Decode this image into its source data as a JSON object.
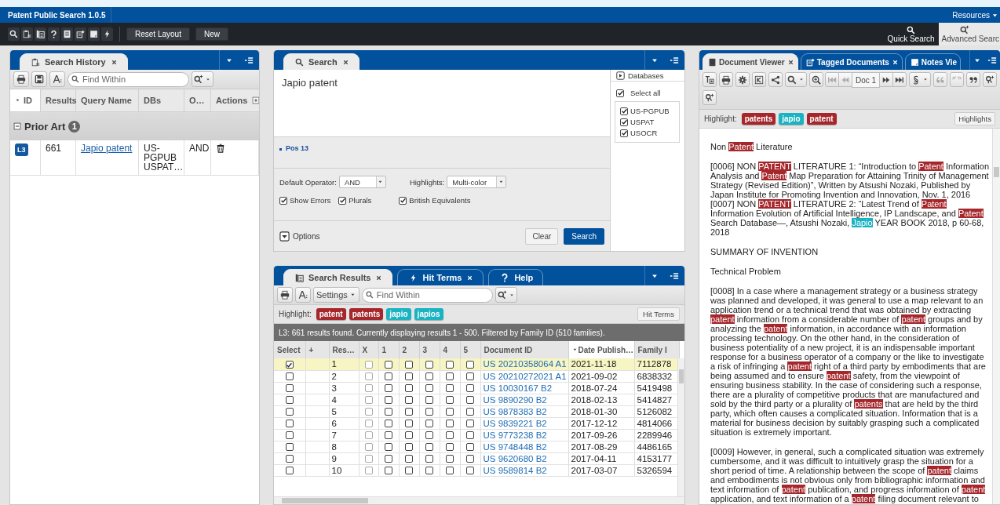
{
  "app": {
    "title": "Patent Public Search 1.0.5",
    "resources_menu": "Resources"
  },
  "toolbar": {
    "buttons": [
      "Reset Layout",
      "New"
    ],
    "quick_search": "Quick Search",
    "advanced_search": "Advanced Searc"
  },
  "search_history": {
    "tabs": [
      {
        "label": "Search History",
        "selected": true
      }
    ],
    "find_placeholder": "Find Within",
    "columns": [
      {
        "label": "ID",
        "sorted": true
      },
      {
        "label": "Results",
        "sorted": false
      },
      {
        "label": "Query Name",
        "sorted": false
      },
      {
        "label": "DBs",
        "sorted": false
      },
      {
        "label": "O…",
        "sorted": false
      },
      {
        "label": "Actions",
        "sorted": false
      }
    ],
    "group": {
      "name": "Prior Art",
      "count": "1",
      "expanded": true
    },
    "rows": [
      {
        "id": "L3",
        "results": "661",
        "query": "Japio patent",
        "dbs": "US-PGPUB USPAT…",
        "operator": "AND"
      }
    ]
  },
  "search": {
    "tabs": [
      {
        "label": "Search",
        "selected": true
      }
    ],
    "query": "Japio patent",
    "position": "Pos 13",
    "default_operator": {
      "label": "Default Operator:",
      "value": "AND"
    },
    "highlights": {
      "label": "Highlights:",
      "value": "Multi-color"
    },
    "options": [
      {
        "label": "Show Errors",
        "checked": true
      },
      {
        "label": "Plurals",
        "checked": true
      },
      {
        "label": "British Equivalents",
        "checked": true
      }
    ],
    "options_toggle": "Options",
    "buttons": [
      "Clear",
      "Search"
    ],
    "databases": {
      "title": "Databases",
      "select_all": {
        "label": "Select all",
        "checked": true
      },
      "items": [
        {
          "label": "US-PGPUB",
          "checked": true
        },
        {
          "label": "USPAT",
          "checked": true
        },
        {
          "label": "USOCR",
          "checked": true
        }
      ]
    }
  },
  "results": {
    "tabs": [
      {
        "label": "Search Results",
        "selected": true
      },
      {
        "label": "Hit Terms",
        "selected": false
      },
      {
        "label": "Help",
        "selected": false
      }
    ],
    "settings": "Settings",
    "find_placeholder": "Find Within",
    "highlight_label": "Highlight:",
    "terms": [
      {
        "text": "patent",
        "color": "#a5262b"
      },
      {
        "text": "patents",
        "color": "#a5262b"
      },
      {
        "text": "japio",
        "color": "#19b3c2"
      },
      {
        "text": "japios",
        "color": "#19b3c2"
      }
    ],
    "hit_terms_button": "Hit Terms",
    "status": "L3: 661 results found. Currently displaying results 1 - 500. Filtered by Family ID (510 families).",
    "columns": [
      {
        "label": "Select",
        "sorted": false
      },
      {
        "label": "+",
        "sorted": false
      },
      {
        "label": "Res…",
        "sorted": false
      },
      {
        "label": "X",
        "sorted": false
      },
      {
        "label": "1",
        "sorted": false
      },
      {
        "label": "2",
        "sorted": false
      },
      {
        "label": "3",
        "sorted": false
      },
      {
        "label": "4",
        "sorted": false
      },
      {
        "label": "5",
        "sorted": false
      },
      {
        "label": "Document ID",
        "sorted": false
      },
      {
        "label": "Date Publish…",
        "sorted": true
      },
      {
        "label": "Family I",
        "sorted": false
      }
    ],
    "rows": [
      {
        "selected": true,
        "checked": true,
        "result": "1",
        "marks": [
          false,
          false,
          false,
          false,
          false,
          false
        ],
        "document_id": "US 20210358064 A1",
        "date": "2021-11-18",
        "family_id": "7112878"
      },
      {
        "selected": false,
        "checked": false,
        "result": "2",
        "marks": [
          false,
          false,
          false,
          false,
          false,
          false
        ],
        "document_id": "US 20210272021 A1",
        "date": "2021-09-02",
        "family_id": "6838332"
      },
      {
        "selected": false,
        "checked": false,
        "result": "3",
        "marks": [
          false,
          false,
          false,
          false,
          false,
          false
        ],
        "document_id": "US 10030167 B2",
        "date": "2018-07-24",
        "family_id": "5419498"
      },
      {
        "selected": false,
        "checked": false,
        "result": "4",
        "marks": [
          false,
          false,
          false,
          false,
          false,
          false
        ],
        "document_id": "US 9890290 B2",
        "date": "2018-02-13",
        "family_id": "5414827"
      },
      {
        "selected": false,
        "checked": false,
        "result": "5",
        "marks": [
          false,
          false,
          false,
          false,
          false,
          false
        ],
        "document_id": "US 9878383 B2",
        "date": "2018-01-30",
        "family_id": "5126082"
      },
      {
        "selected": false,
        "checked": false,
        "result": "6",
        "marks": [
          false,
          false,
          false,
          false,
          false,
          false
        ],
        "document_id": "US 9839221 B2",
        "date": "2017-12-12",
        "family_id": "4814066"
      },
      {
        "selected": false,
        "checked": false,
        "result": "7",
        "marks": [
          false,
          false,
          false,
          false,
          false,
          false
        ],
        "document_id": "US 9773238 B2",
        "date": "2017-09-26",
        "family_id": "2289946"
      },
      {
        "selected": false,
        "checked": false,
        "result": "8",
        "marks": [
          false,
          false,
          false,
          false,
          false,
          false
        ],
        "document_id": "US 9748448 B2",
        "date": "2017-08-29",
        "family_id": "4486165"
      },
      {
        "selected": false,
        "checked": false,
        "result": "9",
        "marks": [
          false,
          false,
          false,
          false,
          false,
          false
        ],
        "document_id": "US 9620680 B2",
        "date": "2017-04-11",
        "family_id": "4153177"
      },
      {
        "selected": false,
        "checked": false,
        "result": "10",
        "marks": [
          false,
          false,
          false,
          false,
          false,
          false
        ],
        "document_id": "US 9589814 B2",
        "date": "2017-03-07",
        "family_id": "5326594"
      }
    ]
  },
  "doc_viewer": {
    "tabs": [
      {
        "label": "Document Viewer",
        "selected": true
      },
      {
        "label": "Tagged Documents",
        "selected": false
      },
      {
        "label": "Notes Vie",
        "selected": false
      }
    ],
    "doc_position": "Doc 1",
    "highlight_label": "Highlight:",
    "terms": [
      {
        "text": "patents",
        "color": "#a5262b"
      },
      {
        "text": "japio",
        "color": "#19b3c2"
      },
      {
        "text": "patent",
        "color": "#a5262b"
      }
    ],
    "highlights_button": "Highlights",
    "blocks": [
      [
        [
          "Non ",
          {
            "text": "Patent",
            "color": "#a5262b"
          },
          " Literature"
        ]
      ],
      [
        [
          "[0006] NON ",
          {
            "text": "PATENT",
            "color": "#a5262b"
          },
          " LITERATURE 1: “Introduction to ",
          {
            "text": "Patent",
            "color": "#a5262b"
          },
          " Information Analysis and ",
          {
            "text": "Patent",
            "color": "#a5262b"
          },
          " Map Preparation for Attaining Trinity of Management Strategy (Revised Edition)”, Written by Atsushi Nozaki, Published by Japan Institute for Promoting Invention and Innovation, Nov. 1, 2016"
        ],
        [
          "[0007] NON ",
          {
            "text": "PATENT",
            "color": "#a5262b"
          },
          " LITERATURE 2: “Latest Trend of ",
          {
            "text": "Patent",
            "color": "#a5262b"
          },
          " Information Evolution of Artificial Intelligence, IP Landscape, and ",
          {
            "text": "Patent",
            "color": "#a5262b"
          },
          " Search Database—, Atsushi Nozaki, ",
          {
            "text": "Japio",
            "color": "#19b3c2"
          },
          " YEAR BOOK 2018, p 60-68, 2018"
        ]
      ],
      [
        [
          "SUMMARY OF INVENTION"
        ]
      ],
      [
        [
          "Technical Problem"
        ]
      ],
      [
        [
          "[0008] In a case where a management strategy or a business strategy was planned and developed, it was general to use a map relevant to an application trend or a technical trend that was obtained by extracting ",
          {
            "text": "patent",
            "color": "#a5262b"
          },
          " information from a considerable number of ",
          {
            "text": "patent",
            "color": "#a5262b"
          },
          " groups and by analyzing the ",
          {
            "text": "patent",
            "color": "#a5262b"
          },
          " information, in accordance with an information processing technology. On the other hand, in the consideration of business potentiality of a new project, it is an indispensable important response for a business operator of a company or the like to investigate a risk of infringing a ",
          {
            "text": "patent",
            "color": "#a5262b"
          },
          " right of a third party by embodiments that are being assumed and to ensure ",
          {
            "text": "patent",
            "color": "#a5262b"
          },
          " safety, from the viewpoint of ensuring business stability. In the case of considering such a response, there are a plurality of competitive products that are manufactured and sold by the third party or a plurality of ",
          {
            "text": "patents",
            "color": "#a5262b"
          },
          " that are held by the third party, which often causes a complicated situation. Information that is a material for business decision by suitably grasping such a complicated situation is extremely important."
        ]
      ],
      [
        [
          "[0009] However, in general, such a complicated situation was extremely cumbersome, and it was difficult to intuitively grasp the situation for a short period of time. A relationship between the scope of ",
          {
            "text": "patent",
            "color": "#a5262b"
          },
          " claims and embodiments is not obvious only from bibliographic information and text information of ",
          {
            "text": "patent",
            "color": "#a5262b"
          },
          " publication, and progress information of ",
          {
            "text": "patent",
            "color": "#a5262b"
          },
          " application, and text information of a ",
          {
            "text": "patent",
            "color": "#a5262b"
          },
          " filing document relevant to"
        ]
      ]
    ]
  }
}
